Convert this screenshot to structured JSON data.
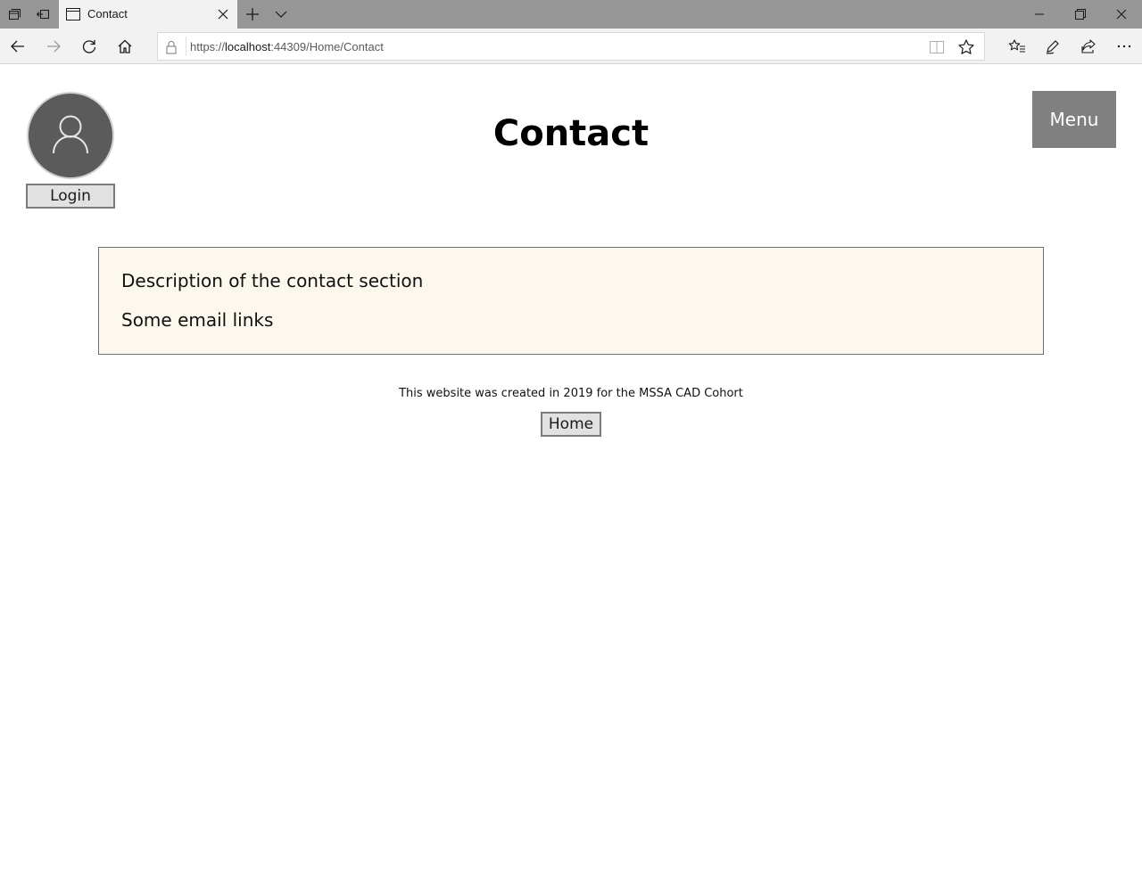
{
  "browser": {
    "tab": {
      "title": "Contact",
      "icon": "page-icon",
      "close_icon": "close-icon"
    },
    "titlebar_icons": [
      "tab-set-aside-icon",
      "restore-tabs-icon",
      "new-tab-icon",
      "tab-preview-chevron-icon"
    ],
    "window_controls": [
      "minimize-icon",
      "restore-icon",
      "close-icon"
    ],
    "address": {
      "scheme": "https://",
      "host": "localhost",
      "rest": ":44309/Home/Contact"
    },
    "nav_icons": [
      "back-icon",
      "forward-icon",
      "refresh-icon",
      "home-icon"
    ],
    "toolbar_icons": [
      "favorites-icon",
      "notes-icon",
      "share-icon",
      "more-icon"
    ]
  },
  "header": {
    "title": "Contact",
    "login_label": "Login",
    "menu_label": "Menu",
    "avatar_icon": "user-icon"
  },
  "contact": {
    "description": "Description of the contact section",
    "email_links": "Some email links"
  },
  "footer": {
    "text": "This website was created in 2019 for the MSSA CAD Cohort",
    "home_label": "Home"
  },
  "colors": {
    "titlebar": "#969696",
    "menu_button": "#808080",
    "avatar": "#5b5b5b",
    "contact_box_bg": "#fdf8ee"
  }
}
